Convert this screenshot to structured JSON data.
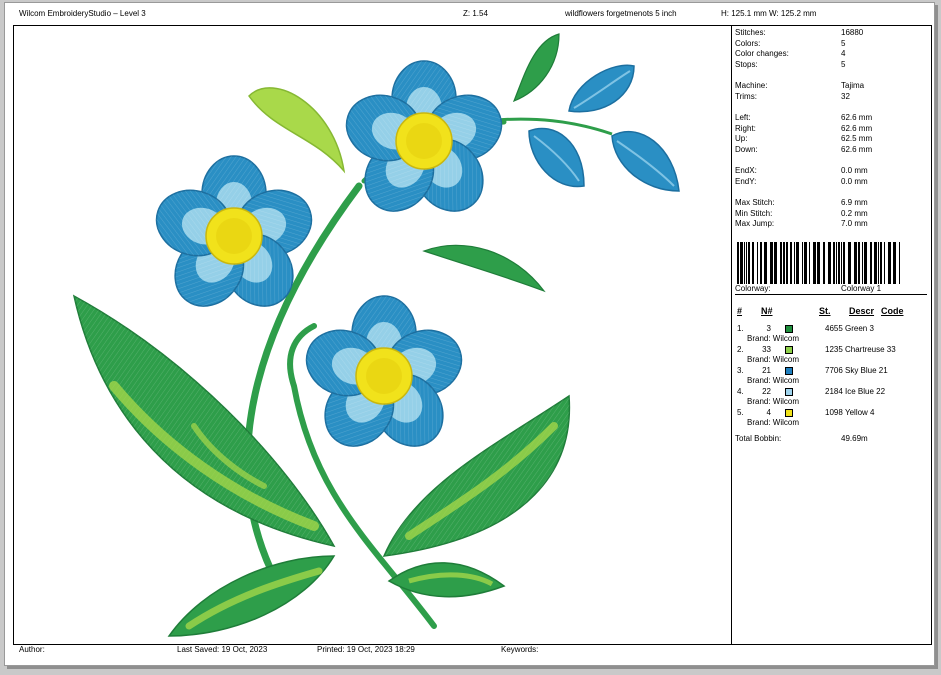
{
  "header": {
    "app_title": "Wilcom EmbroideryStudio – Level 3",
    "zoom": "Z: 1.54",
    "design_name": "wildflowers forgetmenots 5 inch",
    "dims": "H: 125.1 mm   W: 125.2 mm"
  },
  "stats": [
    {
      "label": "Stitches:",
      "value": "16880"
    },
    {
      "label": "Colors:",
      "value": "5"
    },
    {
      "label": "Color changes:",
      "value": "4"
    },
    {
      "label": "Stops:",
      "value": "5"
    },
    {
      "label": "Machine:",
      "value": "Tajima"
    },
    {
      "label": "Trims:",
      "value": "32"
    },
    {
      "label": "Left:",
      "value": "62.6 mm"
    },
    {
      "label": "Right:",
      "value": "62.6 mm"
    },
    {
      "label": "Up:",
      "value": "62.5 mm"
    },
    {
      "label": "Down:",
      "value": "62.6 mm"
    },
    {
      "label": "EndX:",
      "value": "0.0 mm"
    },
    {
      "label": "EndY:",
      "value": "0.0 mm"
    },
    {
      "label": "Max Stitch:",
      "value": "6.9 mm"
    },
    {
      "label": "Min Stitch:",
      "value": "0.2 mm"
    },
    {
      "label": "Max Jump:",
      "value": "7.0 mm"
    }
  ],
  "colorway": {
    "label": "Colorway:",
    "value": "Colorway 1"
  },
  "table": {
    "headers": {
      "num": "#",
      "n": "N#",
      "st": "St.",
      "descr": "Descr",
      "code": "Code"
    },
    "rows": [
      {
        "num": "1.",
        "n": "3",
        "st": "4655",
        "descr": "Green 3",
        "brand": "Brand: Wilcom",
        "color": "#1f8f3c"
      },
      {
        "num": "2.",
        "n": "33",
        "st": "1235",
        "descr": "Chartreuse 33",
        "brand": "Brand: Wilcom",
        "color": "#8fd14a"
      },
      {
        "num": "3.",
        "n": "21",
        "st": "7706",
        "descr": "Sky Blue 21",
        "brand": "Brand: Wilcom",
        "color": "#1e7fbf"
      },
      {
        "num": "4.",
        "n": "22",
        "st": "2184",
        "descr": "Ice Blue 22",
        "brand": "Brand: Wilcom",
        "color": "#9fd3ec"
      },
      {
        "num": "5.",
        "n": "4",
        "st": "1098",
        "descr": "Yellow 4",
        "brand": "Brand: Wilcom",
        "color": "#f0e21a"
      }
    ],
    "total_label": "Total Bobbin:",
    "total_value": "49.69m"
  },
  "footer": {
    "author": "Author:",
    "last_saved": "Last Saved: 19 Oct, 2023",
    "printed": "Printed: 19 Oct, 2023 18:29",
    "keywords": "Keywords:"
  },
  "design_colors": {
    "leaf_green": "#2e9e4a",
    "leaf_dark": "#1f7d39",
    "chartreuse": "#a9d94a",
    "sky_blue": "#2a8fc4",
    "ice_blue": "#a8dcef",
    "yellow": "#f1e21b"
  }
}
